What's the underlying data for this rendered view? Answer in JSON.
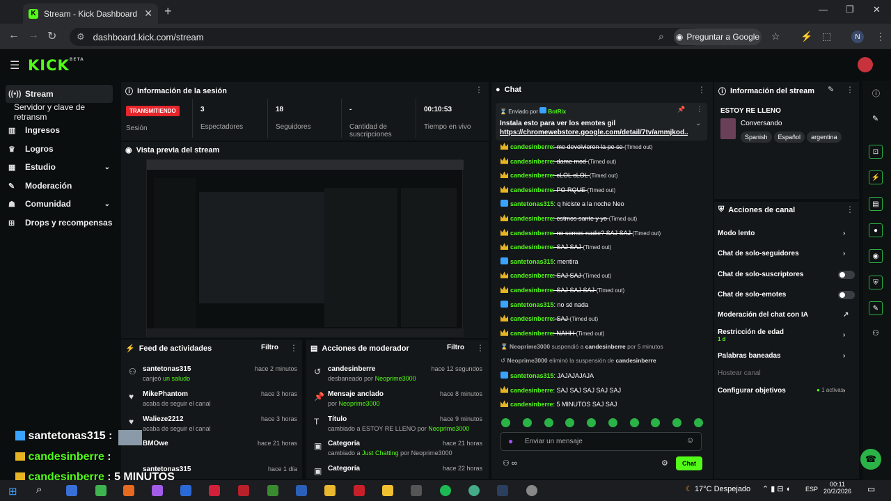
{
  "browser": {
    "tab_title": "Stream - Kick Dashboard",
    "url": "dashboard.kick.com/stream",
    "google_btn": "Preguntar a Google",
    "profile_letter": "N"
  },
  "kick": {
    "logo": "KICK",
    "logo_sup": "BETA"
  },
  "sidebar": {
    "items": [
      {
        "label": "Stream",
        "icon": "broadcast-icon"
      },
      {
        "label": "Servidor y clave de retransm",
        "icon": ""
      },
      {
        "label": "Ingresos",
        "icon": "chart-icon"
      },
      {
        "label": "Logros",
        "icon": "trophy-icon"
      },
      {
        "label": "Estudio",
        "icon": "studio-icon"
      },
      {
        "label": "Moderación",
        "icon": "wrench-icon"
      },
      {
        "label": "Comunidad",
        "icon": "community-icon"
      },
      {
        "label": "Drops y recompensas",
        "icon": "gift-icon"
      }
    ]
  },
  "session": {
    "title": "Información de la sesión",
    "live_badge": "TRANSMITIENDO",
    "live_label": "Sesión",
    "stats": [
      {
        "value": "3",
        "label": "Espectadores"
      },
      {
        "value": "18",
        "label": "Seguidores"
      },
      {
        "value": "-",
        "label": "Cantidad de suscripciones"
      },
      {
        "value": "00:10:53",
        "label": "Tiempo en vivo"
      }
    ]
  },
  "preview": {
    "title": "Vista previa del stream"
  },
  "feed": {
    "title": "Feed de actividades",
    "filter": "Filtro",
    "items": [
      {
        "name": "santetonas315",
        "sub": "canjeó",
        "sub2": "un saludo",
        "time": "hace 2 minutos"
      },
      {
        "name": "MikePhantom",
        "sub": "acaba de seguir el canal",
        "sub2": "",
        "time": "hace 3 horas"
      },
      {
        "name": "Walieze2212",
        "sub": "acaba de seguir el canal",
        "sub2": "",
        "time": "hace 3 horas"
      },
      {
        "name": "BMOwe",
        "sub": "",
        "sub2": "",
        "time": "hace 21 horas"
      },
      {
        "name": "santetonas315",
        "sub": "",
        "sub2": "",
        "time": "hace 1 día"
      }
    ]
  },
  "modactions": {
    "title": "Acciones de moderador",
    "filter": "Filtro",
    "items": [
      {
        "name": "candesinberre",
        "sub": "desbaneado por",
        "sub2": "Neoprime3000",
        "time": "hace 12 segundos"
      },
      {
        "name": "Mensaje anclado",
        "sub": "por",
        "sub2": "Neoprime3000",
        "time": "hace 8 minutos"
      },
      {
        "name": "Título",
        "sub": "cambiado a ESTOY RE LLENO por",
        "sub2": "Neoprime3000",
        "time": "hace 9 minutos"
      },
      {
        "name": "Categoría",
        "sub": "cambiado a",
        "sub2": "Just Chatting",
        "sub3": "por Neoprime3000",
        "time": "hace 21 horas"
      },
      {
        "name": "Categoría",
        "sub": "",
        "sub2": "",
        "time": "hace 22 horas"
      }
    ]
  },
  "chat": {
    "title": "Chat",
    "pinned_by": "Enviado por",
    "pinned_user": "BotRix",
    "pinned_text": "Instala esto para ver los emotes gil",
    "pinned_link": "https://chromewebstore.google.com/detail/7tv/ammjkod...",
    "messages": [
      {
        "user": "candesinberre",
        "text": "me devolvieron la pe se",
        "to": "(Timed out)",
        "badge": "crown"
      },
      {
        "user": "candesinberre",
        "text": "dame mod",
        "to": "(Timed out)",
        "badge": "crown"
      },
      {
        "user": "candesinberre",
        "text": "cLOL cLOL",
        "to": "(Timed out)",
        "badge": "crown"
      },
      {
        "user": "candesinberre",
        "text": "PO RQUE",
        "to": "(Timed out)",
        "badge": "crown"
      },
      {
        "user": "santetonas315",
        "text": "q hiciste a la noche Neo",
        "to": "",
        "badge": "star"
      },
      {
        "user": "candesinberre",
        "text": "estmos sante y yo",
        "to": "(Timed out)",
        "badge": "crown"
      },
      {
        "user": "candesinberre",
        "text": "no somos nadie? SAJ SAJ",
        "to": "(Timed out)",
        "badge": "crown"
      },
      {
        "user": "candesinberre",
        "text": "SAJ SAJ",
        "to": "(Timed out)",
        "badge": "crown"
      },
      {
        "user": "santetonas315",
        "text": "mentira",
        "to": "",
        "badge": "star"
      },
      {
        "user": "candesinberre",
        "text": "SAJ SAJ",
        "to": "(Timed out)",
        "badge": "crown"
      },
      {
        "user": "candesinberre",
        "text": "SAJ SAJ SAJ",
        "to": "(Timed out)",
        "badge": "crown"
      },
      {
        "user": "santetonas315",
        "text": "no sé nada",
        "to": "",
        "badge": "star"
      },
      {
        "user": "candesinberre",
        "text": "SAJ",
        "to": "(Timed out)",
        "badge": "crown"
      },
      {
        "user": "candesinberre",
        "text": "NAHH",
        "to": "(Timed out)",
        "badge": "crown"
      }
    ],
    "sys1": {
      "a": "Neoprime3000",
      "b": "suspendió a",
      "c": "candesinberre",
      "d": "por 5 minutos"
    },
    "sys2": {
      "a": "Neoprime3000",
      "b": "eliminó la suspensión de",
      "c": "candesinberre"
    },
    "messages2": [
      {
        "user": "santetonas315",
        "text": "JAJAJAJAJA",
        "badge": "star"
      },
      {
        "user": "candesinberre",
        "text": "SAJ SAJ SAJ SAJ SAJ",
        "badge": "crown"
      },
      {
        "user": "candesinberre",
        "text": "5 MINUTOS SAJ SAJ",
        "badge": "crown"
      }
    ],
    "input_placeholder": "Enviar un mensaje",
    "send": "Chat"
  },
  "streaminfo": {
    "title": "Información del stream",
    "stream_title": "ESTOY RE LLENO",
    "category": "Conversando",
    "tags": [
      "Spanish",
      "Español",
      "argentina"
    ]
  },
  "channel": {
    "title": "Acciones de canal",
    "rows": [
      {
        "label": "Modo lento"
      },
      {
        "label": "Chat de solo-seguidores"
      },
      {
        "label": "Chat de solo-suscriptores"
      },
      {
        "label": "Chat de solo-emotes"
      },
      {
        "label": "Moderación del chat con IA"
      },
      {
        "label": "Restricción de edad",
        "sub": "1 d"
      },
      {
        "label": "Palabras baneadas"
      },
      {
        "label": "Hostear canal"
      },
      {
        "label": "Configurar objetivos",
        "extra": "1 activas"
      }
    ]
  },
  "overlay": [
    {
      "user": "santetonas315",
      "text": ":"
    },
    {
      "user": "candesinberre",
      "text": ":"
    },
    {
      "user": "candesinberre",
      "text": ": 5 MINUTOS"
    }
  ],
  "taskbar": {
    "weather": "17°C Despejado",
    "lang": "ESP",
    "time": "00:11",
    "date": "20/2/2026"
  },
  "colors": {
    "accent": "#53fc18",
    "live": "#e5262c",
    "panel": "#141719"
  }
}
